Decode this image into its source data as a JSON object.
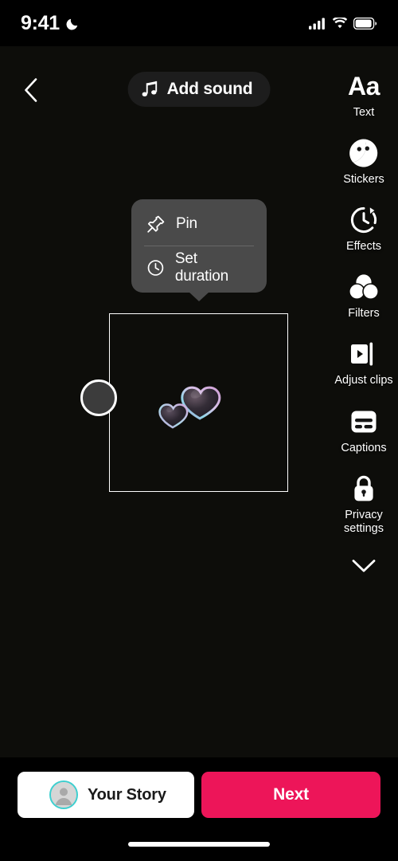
{
  "status_bar": {
    "time": "9:41",
    "dnd_icon": "moon-icon",
    "signal_icon": "cellular-signal-icon",
    "wifi_icon": "wifi-icon",
    "battery_icon": "battery-icon"
  },
  "header": {
    "back_icon": "chevron-left-icon",
    "sound_button": {
      "label": "Add sound",
      "icon": "music-note-icon"
    }
  },
  "popover": {
    "items": [
      {
        "label": "Pin",
        "icon": "pin-icon"
      },
      {
        "label": "Set duration",
        "icon": "clock-icon"
      }
    ]
  },
  "toolrail": {
    "items": [
      {
        "label": "Text",
        "icon": "text-aa-icon"
      },
      {
        "label": "Stickers",
        "icon": "sticker-smiley-icon"
      },
      {
        "label": "Effects",
        "icon": "effects-timer-icon"
      },
      {
        "label": "Filters",
        "icon": "filters-circles-icon"
      },
      {
        "label": "Adjust clips",
        "icon": "adjust-clips-icon"
      },
      {
        "label": "Captions",
        "icon": "captions-icon"
      },
      {
        "label": "Privacy\nsettings",
        "icon": "lock-icon"
      }
    ],
    "collapse_icon": "chevron-down-icon"
  },
  "canvas": {
    "sticker": "heart-bubbles-sticker",
    "selection_frame": "sticker-selection-frame",
    "resize_handle": "resize-handle"
  },
  "bottom_bar": {
    "story_button": {
      "label": "Your Story",
      "avatar_icon": "user-avatar-icon"
    },
    "next_button": {
      "label": "Next"
    },
    "home_indicator": "home-indicator"
  },
  "colors": {
    "background": "#0d0d0a",
    "accent_pink": "#ed1559",
    "popover_bg": "#4a4a4a",
    "avatar_ring": "#3ecfcf",
    "white": "#ffffff"
  }
}
